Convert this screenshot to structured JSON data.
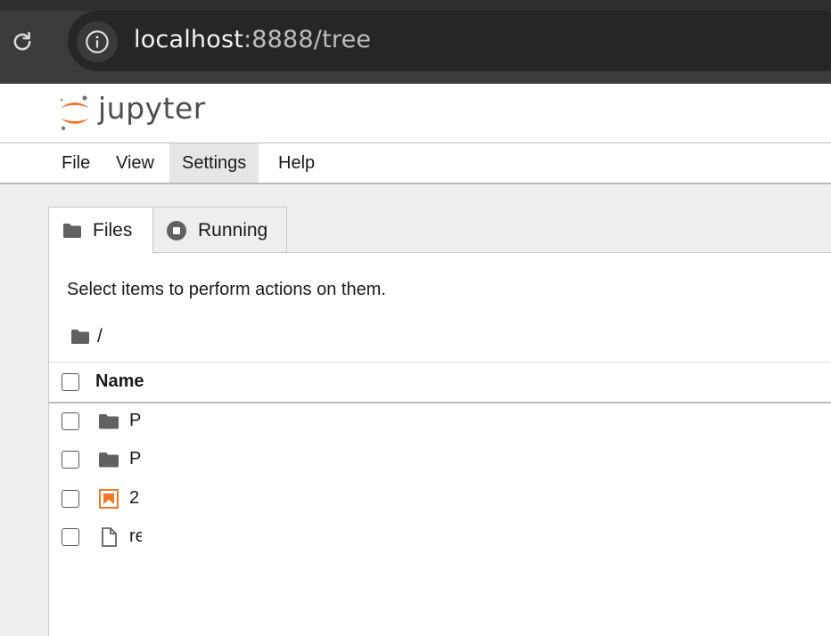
{
  "browser": {
    "url_host": "localhost",
    "url_rest": ":8888/tree",
    "reload_icon": "reload-icon",
    "info_icon": "info-icon"
  },
  "header": {
    "brand": "jupyter",
    "logo_colors": {
      "orange": "#F37726",
      "gray": "#767677"
    }
  },
  "menu": {
    "items": [
      {
        "label": "File"
      },
      {
        "label": "View"
      },
      {
        "label": "Settings"
      },
      {
        "label": "Help"
      }
    ],
    "active": "Settings"
  },
  "tabs": [
    {
      "label": "Files",
      "icon": "folder-icon",
      "selected": true
    },
    {
      "label": "Running",
      "icon": "stop-circle-icon",
      "selected": false
    }
  ],
  "filebrowser": {
    "hint": "Select items to perform actions on them.",
    "breadcrumb": "/",
    "column_name": "Name",
    "rows": [
      {
        "name": "P",
        "icon": "folder-icon"
      },
      {
        "name": "P",
        "icon": "folder-icon"
      },
      {
        "name": "2",
        "icon": "image-file-icon"
      },
      {
        "name": "re",
        "icon": "file-icon"
      }
    ]
  }
}
